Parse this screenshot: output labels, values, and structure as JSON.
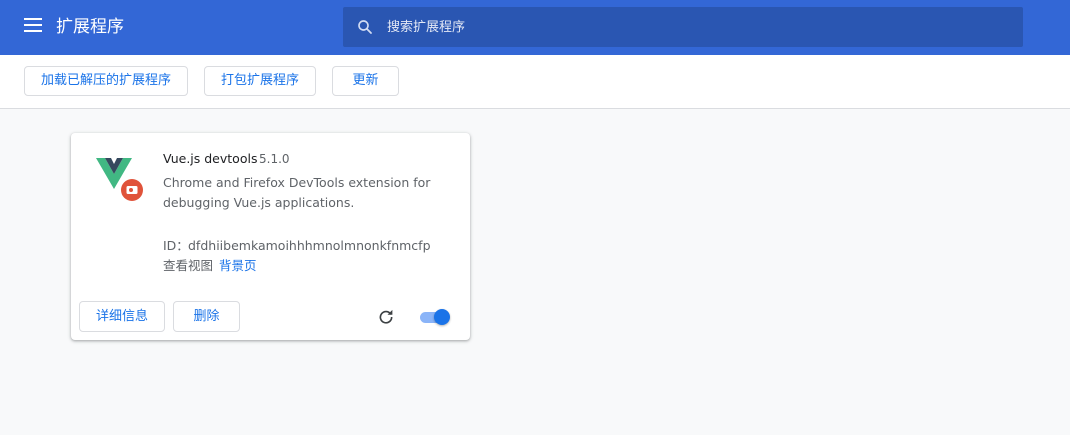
{
  "header": {
    "title": "扩展程序",
    "search_placeholder": "搜索扩展程序",
    "icons": [
      "menu-icon",
      "search-icon"
    ]
  },
  "toolbar": {
    "load_unpacked": "加载已解压的扩展程序",
    "pack": "打包扩展程序",
    "update": "更新"
  },
  "extension": {
    "name": "Vue.js devtools",
    "version": "5.1.0",
    "description": "Chrome and Firefox DevTools extension for debugging Vue.js applications.",
    "id_label": "ID：",
    "id": "dfdhiibemkamoihhhmnolmnonkfnmcfp",
    "views_label": "查看视图",
    "views_link": "背景页",
    "details_button": "详细信息",
    "remove_button": "删除",
    "enabled": true,
    "icons": [
      "vue-logo-icon",
      "reload-icon"
    ]
  },
  "colors": {
    "header_bg": "#3367d6",
    "search_bg": "#2a56b2",
    "accent": "#1a73e8",
    "page_bg": "#f8f9fa"
  }
}
